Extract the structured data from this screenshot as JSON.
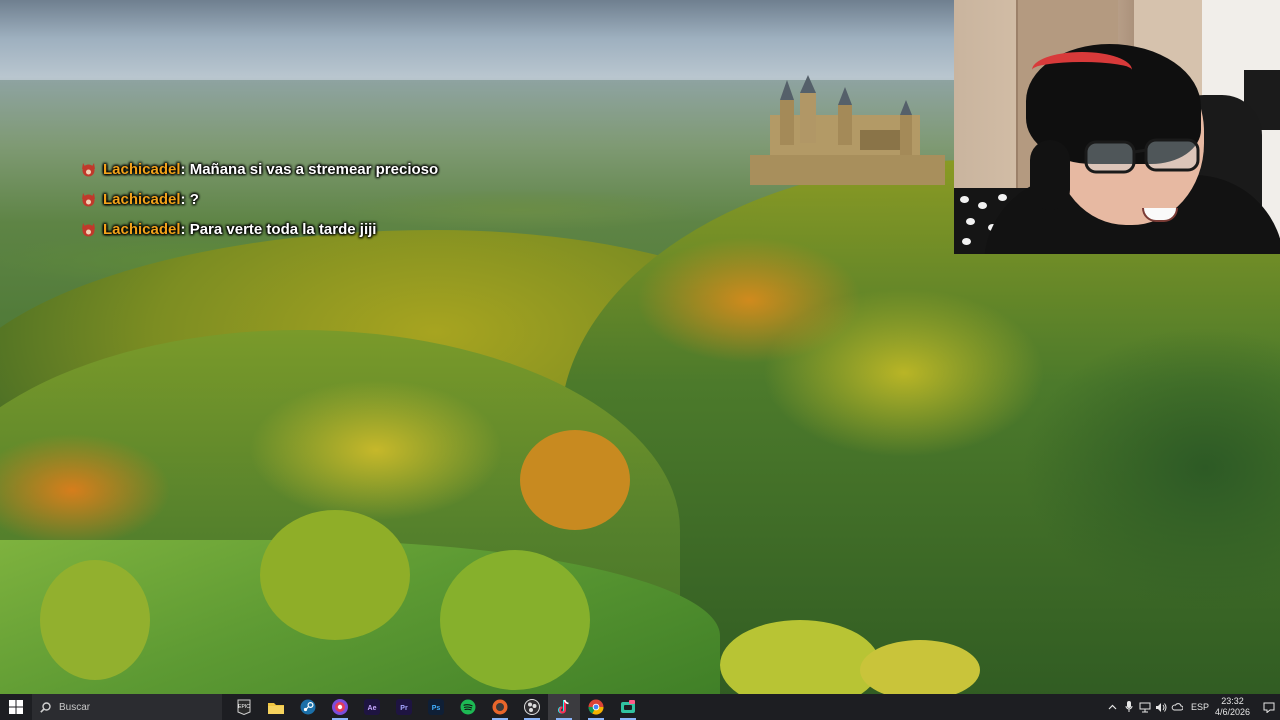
{
  "chat": {
    "messages": [
      {
        "user": "Lachicadel",
        "text": ": Mañana si vas a stremear precioso"
      },
      {
        "user": "Lachicadel",
        "text": ": ?"
      },
      {
        "user": "Lachicadel",
        "text": ": Para verte toda la tarde jiji"
      }
    ],
    "username_color": "#f2a21a"
  },
  "taskbar": {
    "search_placeholder": "Buscar",
    "apps": [
      "epic-games-icon",
      "file-explorer-icon",
      "steam-icon",
      "discord-overlay-icon",
      "after-effects-icon",
      "premiere-pro-icon",
      "photoshop-icon",
      "spotify-icon",
      "brave-icon",
      "obs-icon",
      "tiktok-icon",
      "chrome-icon",
      "streamlabs-icon"
    ],
    "app_labels": {
      "epic": "EPIC",
      "ae": "Ae",
      "pr": "Pr",
      "ps": "Ps"
    },
    "tray": {
      "language": "ESP",
      "time": "23:32",
      "date": "4/6/2026"
    }
  }
}
